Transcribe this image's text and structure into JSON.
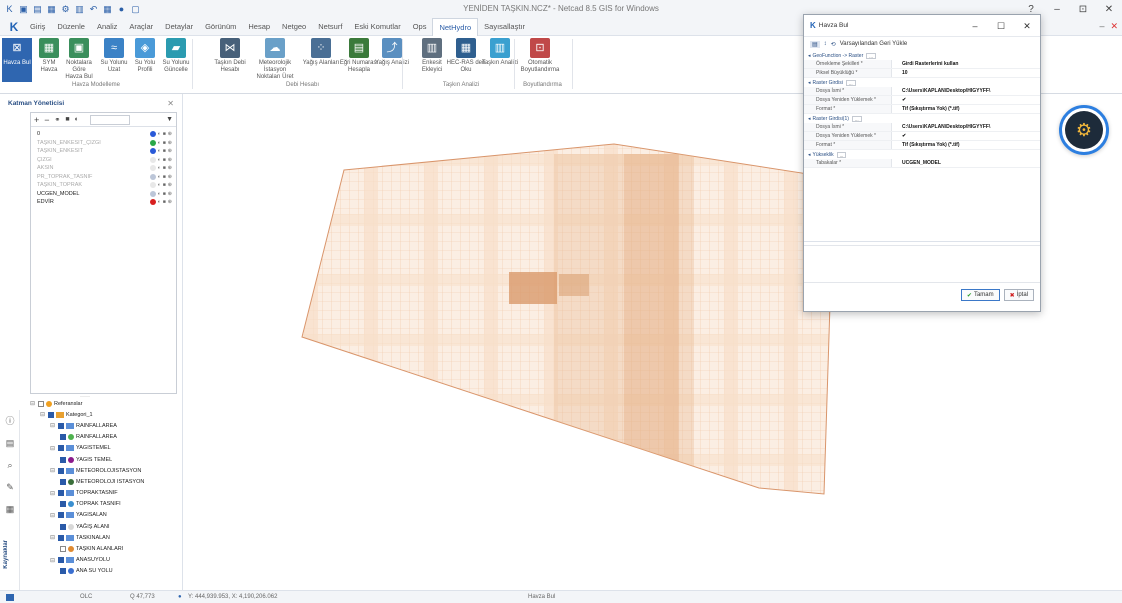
{
  "window": {
    "title": "YENİDEN TAŞKIN.NCZ* - Netcad 8.5 GIS for Windows",
    "help": "?",
    "minimize": "–",
    "maximize": "⊡",
    "close": "✕"
  },
  "menu": {
    "logo": "K",
    "items": [
      "Giriş",
      "Düzenle",
      "Analiz",
      "Araçlar",
      "Detaylar",
      "Görünüm",
      "Hesap",
      "Netgeo",
      "Netsurf",
      "Eski Komutlar",
      "Ops",
      "NetHydro",
      "Sayısallaştır"
    ],
    "active_index": 11
  },
  "ribbon": {
    "buttons": [
      {
        "label": "Havza Bul",
        "icon": "watershed-icon",
        "color": "#2f66b0"
      },
      {
        "label": "SYM Havza",
        "icon": "dem-icon",
        "color": "#3a8f5c"
      },
      {
        "label": "Noktalara Göre Havza Bul",
        "icon": "points-icon",
        "color": "#3a8f5c"
      },
      {
        "label": "Su Yolunu Uzat",
        "icon": "stream-extend-icon",
        "color": "#3b82c6"
      },
      {
        "label": "Su Yolu Profili",
        "icon": "profile-icon",
        "color": "#4a9ad8"
      },
      {
        "label": "Su Yolunu Güncelle",
        "icon": "stream-update-icon",
        "color": "#2b9bb0"
      },
      {
        "label": "Taşkın Debi Hesabı",
        "icon": "flood-icon",
        "color": "#47607a"
      },
      {
        "label": "Meteorolojik İstasyon Noktaları Üret",
        "icon": "weather-icon",
        "color": "#6aa0c8"
      },
      {
        "label": "Yağış Alanları",
        "icon": "rain-icon",
        "color": "#4a6f95"
      },
      {
        "label": "Eğri Numarası Hesapla",
        "icon": "curve-icon",
        "color": "#3b7a3b"
      },
      {
        "label": "Yağış Analizi",
        "icon": "rain-analysis-icon",
        "color": "#5a8fc0"
      },
      {
        "label": "Enkesit Ekleyici",
        "icon": "section-icon",
        "color": "#5f6f7f"
      },
      {
        "label": "HEC-RAS den Oku",
        "icon": "hecras-icon",
        "color": "#2f5f8f"
      },
      {
        "label": "Taşkın Analizi",
        "icon": "flood-analysis-icon",
        "color": "#3aa0d0"
      },
      {
        "label": "Otomatik Boyutlandırma",
        "icon": "auto-size-icon",
        "color": "#c04848"
      }
    ],
    "groups": [
      "Havza Modelleme",
      "Debi Hesabı",
      "Taşkın Analizi",
      "Boyutlandırma"
    ]
  },
  "layers_panel": {
    "title": "Katman Yöneticisi",
    "layers": [
      {
        "name": "0",
        "dark": true
      },
      {
        "name": "TAŞKIN_ENKESIT_ÇIZGI",
        "dark": false
      },
      {
        "name": "TAŞKIN_ENKESIT",
        "dark": false
      },
      {
        "name": "ÇIZGI",
        "dark": false
      },
      {
        "name": "AKSIN",
        "dark": false
      },
      {
        "name": "PR_TOPRAK_TASNIF",
        "dark": false
      },
      {
        "name": "TAŞKIN_TOPRAK",
        "dark": false
      },
      {
        "name": "UCGEN_MODEL",
        "dark": true
      },
      {
        "name": "EDVİR",
        "dark": true
      }
    ]
  },
  "ref_tree": {
    "rows": [
      {
        "label": "Referanslar",
        "level": 0,
        "kind": "root"
      },
      {
        "label": "Kategori_1",
        "level": 1,
        "kind": "cat"
      },
      {
        "label": "RAINFALLAREA",
        "level": 2,
        "kind": "grp"
      },
      {
        "label": "RAINFALLAREA",
        "level": 3,
        "kind": "leaf",
        "color": "#4fb24f"
      },
      {
        "label": "YAGISTEMEL",
        "level": 2,
        "kind": "grp"
      },
      {
        "label": "YAGIS TEMEL",
        "level": 3,
        "kind": "leaf",
        "color": "#8b1a8b"
      },
      {
        "label": "METEOROLOJISTASYON",
        "level": 2,
        "kind": "grp"
      },
      {
        "label": "METEOROLOJI ISTASYON",
        "level": 3,
        "kind": "leaf",
        "color": "#3a6f3a"
      },
      {
        "label": "TOPRAKTASNIF",
        "level": 2,
        "kind": "grp"
      },
      {
        "label": "TOPRAK TASNIFI",
        "level": 3,
        "kind": "leaf",
        "color": "#3a8fd0"
      },
      {
        "label": "YAGISALAN",
        "level": 2,
        "kind": "grp"
      },
      {
        "label": "YAĞIŞ ALANI",
        "level": 3,
        "kind": "leaf",
        "color": "#d8d8d8"
      },
      {
        "label": "TASKINALAN",
        "level": 2,
        "kind": "grp"
      },
      {
        "label": "TAŞKIN ALANLARI",
        "level": 3,
        "kind": "leaf",
        "color": "#e08a30"
      },
      {
        "label": "ANASUYOLU",
        "level": 2,
        "kind": "grp"
      },
      {
        "label": "ANA SU YOLU",
        "level": 3,
        "kind": "leaf",
        "color": "#3a6fd0"
      }
    ]
  },
  "side_strip": {
    "label": "Kaynaklar",
    "icons": [
      "info-icon",
      "layers-icon",
      "search-icon",
      "tools-icon",
      "layers2-icon"
    ]
  },
  "statusbar": {
    "mode": "OLC",
    "zoom": "Q 47,773",
    "coords": "Y: 444,939.953, X: 4,190,206.062",
    "command": "Havza Bul"
  },
  "dialog": {
    "title": "Havza Bul",
    "reload_label": "Varsayılandan Geri Yükle",
    "ok_label": "Tamam",
    "cancel_label": "İptal",
    "sections": [
      {
        "title": "GeoFunction -> Raster",
        "rows": [
          {
            "key": "Örnekleme Şekilleri *",
            "value": "Girdi Rasterlerini kullan"
          },
          {
            "key": "Piksel Büyüklüğü *",
            "value": "10"
          }
        ]
      },
      {
        "title": "Raster Girdisi",
        "rows": [
          {
            "key": "Dosya İsmi *",
            "value": "C:\\Users\\KAPLAN\\Desktop\\HIGYYFF\\"
          },
          {
            "key": "Dosya Yeniden Yüklemek *",
            "value": "✔"
          },
          {
            "key": "Format *",
            "value": "Tif (Sıkıştırma Yok) (*.tif)"
          }
        ]
      },
      {
        "title": "Raster Girdisi(1)",
        "rows": [
          {
            "key": "Dosya İsmi *",
            "value": "C:\\Users\\KAPLAN\\Desktop\\HIGYYFF\\"
          },
          {
            "key": "Dosya Yeniden Yüklemek *",
            "value": "✔"
          },
          {
            "key": "Format *",
            "value": "Tif (Sıkıştırma Yok) (*.tif)"
          }
        ]
      },
      {
        "title": "Yükseklik",
        "rows": [
          {
            "key": "Tabakalar *",
            "value": "UCGEN_MODEL"
          }
        ]
      }
    ]
  },
  "colors": {
    "accent": "#2f66b0",
    "map_fill": "#f3cfb1",
    "map_stroke": "#c98a5f"
  }
}
